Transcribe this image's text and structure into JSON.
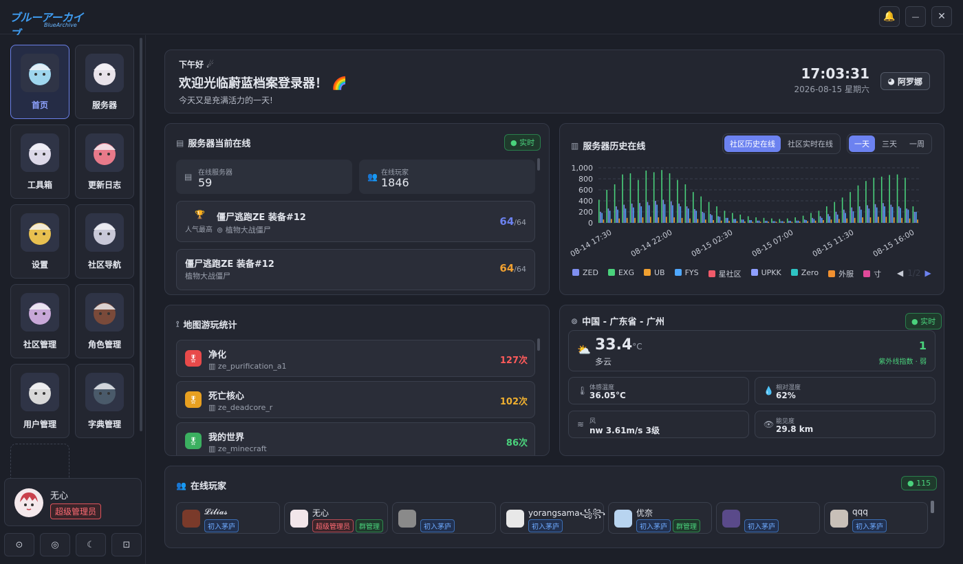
{
  "app": {
    "logo_text": "ブルーアーカイブ",
    "logo_sub": "BlueArchive",
    "window_buttons": {
      "bell": "🔔",
      "minimize": "—",
      "close": "✕"
    }
  },
  "sidebar": {
    "items": [
      {
        "label": "首页",
        "active": true
      },
      {
        "label": "服务器"
      },
      {
        "label": "工具箱"
      },
      {
        "label": "更新日志"
      },
      {
        "label": "设置"
      },
      {
        "label": "社区导航"
      },
      {
        "label": "社区管理"
      },
      {
        "label": "角色管理"
      },
      {
        "label": "用户管理"
      },
      {
        "label": "字典管理"
      }
    ],
    "user": {
      "name": "无心",
      "role": "超级管理员"
    },
    "bottom_icons": [
      "back-icon",
      "target-icon",
      "moon-icon",
      "feedback-icon"
    ]
  },
  "greeting": {
    "hello": "下午好 ☄",
    "welcome": "欢迎光临蔚蓝档案登录器！ 🌈",
    "subtitle": "今天又是充满活力的一天!",
    "time": "17:03:31",
    "date": "2026-08-15 星期六",
    "user_button": "阿罗娜"
  },
  "server_online": {
    "title": "服务器当前在线",
    "badge": "实时",
    "stats": [
      {
        "label": "在线服务器",
        "value": "59"
      },
      {
        "label": "在线玩家",
        "value": "1846"
      }
    ],
    "servers": [
      {
        "name": "僵尸逃跑ZE 装备#12",
        "map": "植物大战僵尸",
        "tag": "人气最高",
        "count": "64",
        "max": "/64"
      },
      {
        "name": "僵尸逃跑ZE 装备#12",
        "map": "植物大战僵尸",
        "count": "64",
        "max": "/64"
      }
    ]
  },
  "history": {
    "title": "服务器历史在线",
    "tabs": [
      "社区历史在线",
      "社区实时在线"
    ],
    "ranges": [
      "一天",
      "三天",
      "一周"
    ],
    "legend": [
      "ZED",
      "EXG",
      "UB",
      "FYS",
      "星社区",
      "UPKK",
      "Zero",
      "外服",
      "寸"
    ],
    "pager": "1/2"
  },
  "chart_data": {
    "type": "bar",
    "y_ticks": [
      "1,000",
      "800",
      "600",
      "400",
      "200",
      "0"
    ],
    "ylim": [
      0,
      1000
    ],
    "x_ticks": [
      "08-14 17:30",
      "08-14 22:00",
      "08-15 02:30",
      "08-15 07:00",
      "08-15 11:30",
      "08-15 16:00"
    ],
    "series": [
      {
        "name": "EXG",
        "color": "#4ad27c",
        "values": [
          420,
          600,
          700,
          880,
          900,
          780,
          950,
          920,
          960,
          900,
          780,
          700,
          560,
          480,
          380,
          300,
          220,
          180,
          150,
          120,
          100,
          90,
          80,
          70,
          80,
          100,
          130,
          180,
          220,
          300,
          380,
          460,
          560,
          680,
          760,
          820,
          840,
          870,
          880,
          820,
          300
        ]
      },
      {
        "name": "ZED",
        "color": "#7f8ff0",
        "values": [
          200,
          260,
          300,
          330,
          350,
          360,
          380,
          400,
          420,
          390,
          350,
          300,
          250,
          200,
          160,
          120,
          90,
          70,
          60,
          50,
          40,
          35,
          30,
          30,
          35,
          40,
          60,
          90,
          120,
          160,
          200,
          240,
          280,
          300,
          320,
          340,
          360,
          330,
          300,
          260,
          200
        ]
      },
      {
        "name": "FYS",
        "color": "#4fa8ff",
        "values": [
          180,
          220,
          240,
          260,
          280,
          300,
          320,
          330,
          340,
          320,
          300,
          260,
          220,
          180,
          140,
          110,
          90,
          70,
          60,
          50,
          40,
          35,
          30,
          30,
          35,
          40,
          50,
          70,
          90,
          120,
          150,
          180,
          210,
          240,
          260,
          280,
          300,
          290,
          270,
          240,
          200
        ]
      },
      {
        "name": "UB",
        "color": "#f0a030",
        "values": [
          60,
          70,
          80,
          90,
          90,
          100,
          110,
          100,
          110,
          100,
          90,
          80,
          70,
          60,
          50,
          40,
          35,
          30,
          25,
          20,
          20,
          20,
          20,
          20,
          20,
          25,
          30,
          40,
          50,
          60,
          70,
          80,
          90,
          100,
          100,
          110,
          110,
          100,
          90,
          80,
          60
        ]
      }
    ]
  },
  "map_stats": {
    "title": "地图游玩统计",
    "maps": [
      {
        "name": "净化",
        "code": "ze_purification_a1",
        "count": "127次",
        "color": "#ff5b5b",
        "icon_bg": "#e84a4a"
      },
      {
        "name": "死亡核心",
        "code": "ze_deadcore_r",
        "count": "102次",
        "color": "#f0b030",
        "icon_bg": "#e8a020"
      },
      {
        "name": "我的世界",
        "code": "ze_minecraft",
        "count": "86次",
        "color": "#4ad27c",
        "icon_bg": "#3bb060"
      }
    ]
  },
  "weather": {
    "location": "中国 - 广东省 - 广州",
    "badge": "实时",
    "temp": "33.4",
    "unit": "°C",
    "condition": "多云",
    "uv": "1",
    "uv_label": "紫外线指数 · 弱",
    "details": [
      {
        "label": "体感温度",
        "value": "36.05°C",
        "icon": "thermometer-icon"
      },
      {
        "label": "相对湿度",
        "value": "62%",
        "icon": "droplet-icon"
      },
      {
        "label": "风",
        "value": "nw 3.61m/s 3级",
        "icon": "wind-icon"
      },
      {
        "label": "能见度",
        "value": "29.8 km",
        "icon": "eye-icon"
      }
    ]
  },
  "players": {
    "title": "在线玩家",
    "count": "115",
    "list": [
      {
        "name": "𝓛𝓲𝓵𝓲𝓪𝓼",
        "tags": [
          {
            "t": "初入茅庐",
            "c": "b"
          }
        ],
        "av": "#7a3a2a"
      },
      {
        "name": "无心",
        "tags": [
          {
            "t": "超级管理员",
            "c": "r"
          },
          {
            "t": "群管理",
            "c": "g"
          }
        ],
        "av": "#f2e6ea"
      },
      {
        "name": "",
        "tags": [
          {
            "t": "初入茅庐",
            "c": "b"
          }
        ],
        "av": "#8a8a8a"
      },
      {
        "name": "yorangsama꧁꧂",
        "tags": [
          {
            "t": "初入茅庐",
            "c": "b"
          }
        ],
        "av": "#e8e8e8"
      },
      {
        "name": "优奈",
        "tags": [
          {
            "t": "初入茅庐",
            "c": "b"
          },
          {
            "t": "群管理",
            "c": "g"
          }
        ],
        "av": "#b8d4f0"
      },
      {
        "name": "",
        "tags": [
          {
            "t": "初入茅庐",
            "c": "b"
          }
        ],
        "av": "#5a4a8a"
      },
      {
        "name": "qqq",
        "tags": [
          {
            "t": "初入茅庐",
            "c": "b"
          }
        ],
        "av": "#c8c0b8"
      }
    ]
  }
}
